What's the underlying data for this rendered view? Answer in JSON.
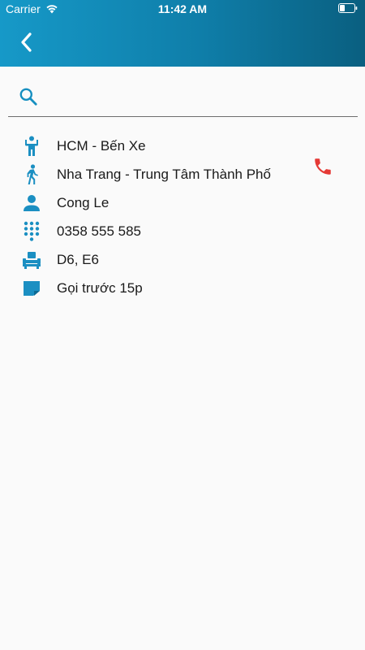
{
  "status_bar": {
    "carrier": "Carrier",
    "time": "11:42 AM",
    "icons": [
      "wifi-icon",
      "battery-icon"
    ]
  },
  "app_bar": {
    "back_icon": "chevron-left-icon",
    "gradient": [
      "#1699c8",
      "#0a5f80"
    ]
  },
  "search": {
    "icon": "search-icon",
    "placeholder": "",
    "value": ""
  },
  "trip": {
    "pickup": {
      "icon": "person-standing-icon",
      "text": "HCM - Bến Xe"
    },
    "dropoff": {
      "icon": "walking-person-icon",
      "text": "Nha Trang - Trung Tâm Thành Phố"
    },
    "customer": {
      "icon": "person-icon",
      "text": "Cong Le"
    },
    "phone": {
      "icon": "dialpad-icon",
      "text": "0358 555 585"
    },
    "seats": {
      "icon": "seat-icon",
      "text": "D6, E6"
    },
    "note": {
      "icon": "note-icon",
      "text": "Gọi trước 15p"
    },
    "call_icon": "phone-call-icon"
  },
  "colors": {
    "accent": "#168fc0",
    "icon": "#1b8fc2",
    "call": "#e53935",
    "background": "#fafafa"
  }
}
